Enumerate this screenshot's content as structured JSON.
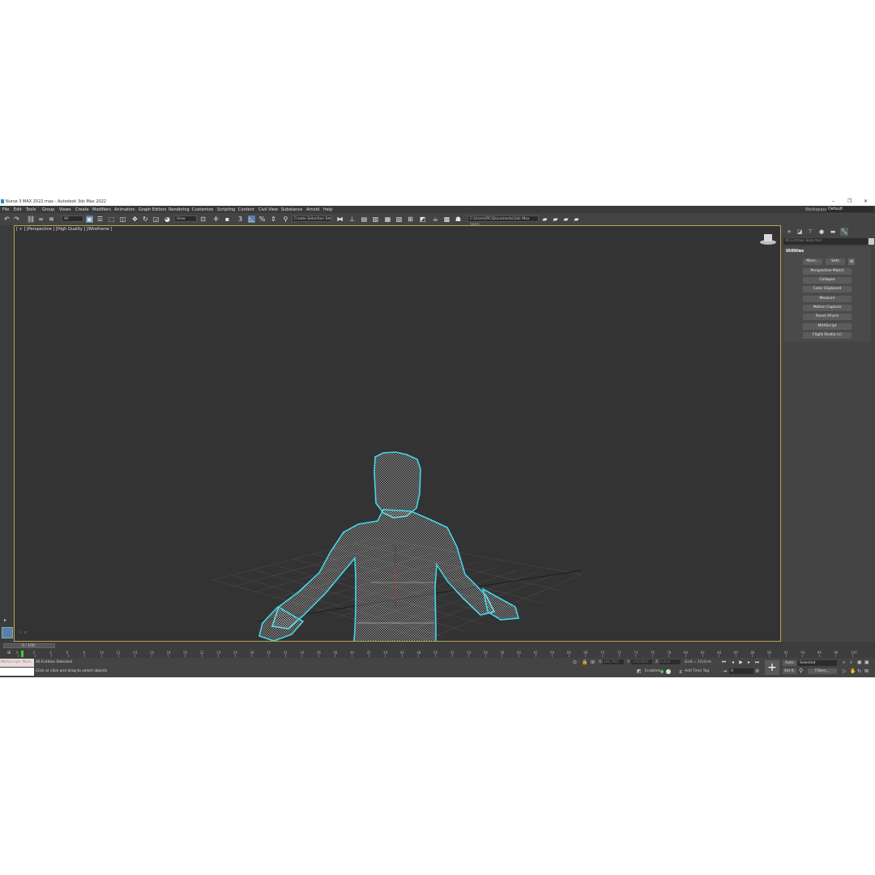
{
  "window": {
    "title": "Nurse 3 MAX 2022.max - Autodesk 3ds Max 2022"
  },
  "menu": {
    "items": [
      "File",
      "Edit",
      "Tools",
      "Group",
      "Views",
      "Create",
      "Modifiers",
      "Animation",
      "Graph Editors",
      "Rendering",
      "Customize",
      "Scripting",
      "Content",
      "Civil View",
      "Substance",
      "Arnold",
      "Help"
    ],
    "workspace_label": "Workspaces:",
    "workspace_value": "Default"
  },
  "toolbar": {
    "filter_value": "All",
    "refcoord_value": "View",
    "selection_set_value": "Create Selection Set",
    "project_path": "C:\\Users\\PC\\Documents\\3ds Max 2022",
    "snap_label": "3"
  },
  "viewport": {
    "label": "[ + ] [Perspective ] [High Quality ] [Wireframe ]"
  },
  "command_panel": {
    "search_placeholder": "46 Entities Selected",
    "rollout_title": "Utilities",
    "more_label": "More...",
    "sets_label": "Sets",
    "buttons": [
      "Perspective Match",
      "Collapse",
      "Color Clipboard",
      "Measure",
      "Motion Capture",
      "Reset XForm",
      "MAXScript",
      "Flight Studio (c)"
    ]
  },
  "timeline": {
    "slider_label": "0 / 100",
    "ticks": [
      "0",
      "2",
      "4",
      "6",
      "8",
      "10",
      "12",
      "14",
      "16",
      "18",
      "20",
      "22",
      "24",
      "26",
      "28",
      "30",
      "32",
      "34",
      "36",
      "38",
      "40",
      "42",
      "44",
      "46",
      "48",
      "50",
      "52",
      "54",
      "56",
      "58",
      "60",
      "62",
      "64",
      "66",
      "68",
      "70",
      "72",
      "74",
      "76",
      "78",
      "80",
      "82",
      "84",
      "86",
      "88",
      "90",
      "92",
      "94",
      "96",
      "98",
      "100"
    ]
  },
  "status": {
    "maxscript_label": "MAXScript Mini",
    "selection_text": "46 Entities Selected",
    "prompt_text": "Click or click and drag to select objects",
    "x_label": "X:",
    "x_value": "104,7945",
    "y_label": "Y:",
    "y_value": "-378,0063",
    "z_label": "Z:",
    "z_value": "0,0cm",
    "grid_text": "Grid = 10,0cm",
    "enabled_label": "Enabled:",
    "add_time_tag": "Add Time Tag",
    "auto_label": "Auto",
    "selected_value": "Selected",
    "setk_label": "Set K.",
    "filters_label": "Filters...",
    "frame_value": "0"
  },
  "colors": {
    "accent_select": "#5a7fa8",
    "viewport_bg": "#333333",
    "viewport_border": "#b7a54a",
    "wire_outline": "#44d6e6"
  }
}
